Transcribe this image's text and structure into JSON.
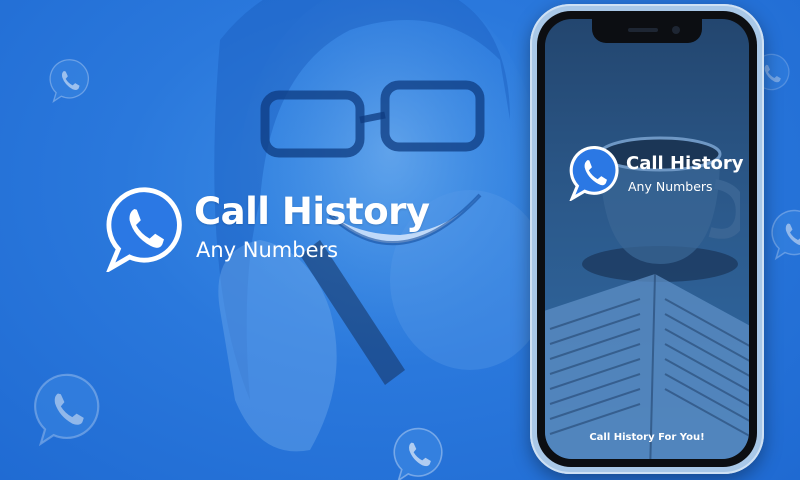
{
  "hero": {
    "title": "Call History",
    "subtitle": "Any Numbers"
  },
  "phone": {
    "app_title": "Call History",
    "app_subtitle": "Any Numbers",
    "tagline": "Call History For You!"
  },
  "icons": {
    "logo": "phone-chat-bubble-icon",
    "background": "phone-bubble-icon"
  },
  "colors": {
    "background": "#2a78dc",
    "logo_blue": "#2b78e4",
    "logo_border": "#ffffff",
    "phone_frame": "#a9c8e8",
    "text": "#ffffff"
  }
}
